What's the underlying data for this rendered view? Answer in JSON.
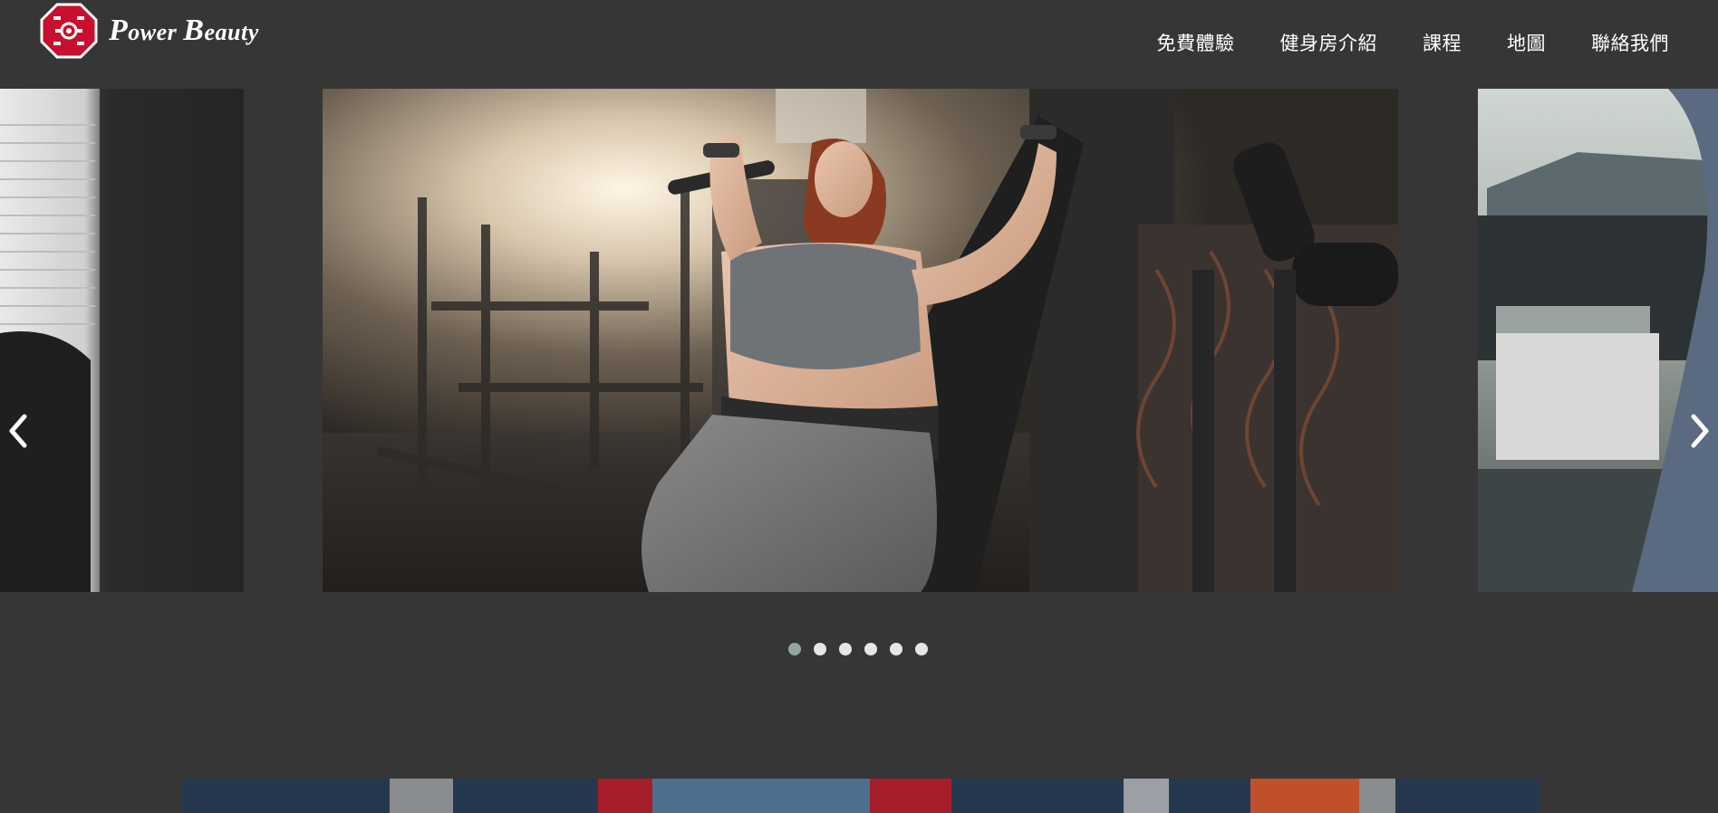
{
  "brand": {
    "name_part1_cap": "P",
    "name_part1": "ower",
    "name_part2_cap": "B",
    "name_part2": "eauty",
    "accent_color": "#c8102e"
  },
  "nav": {
    "items": [
      {
        "label": "免費體驗"
      },
      {
        "label": "健身房介紹"
      },
      {
        "label": "課程"
      },
      {
        "label": "地圖"
      },
      {
        "label": "聯絡我們"
      }
    ]
  },
  "carousel": {
    "prev_icon": "chevron-left-icon",
    "next_icon": "chevron-right-icon",
    "slide_count": 6,
    "active_index": 0,
    "slides": [
      {
        "subject": "woman-on-chest-press-machine"
      },
      {
        "subject": "harbor-scene"
      },
      {
        "subject": "window-blinds-person"
      }
    ],
    "dot_color": "#e6e6e6",
    "dot_active_color": "#97a59f"
  },
  "page": {
    "background": "#363636"
  }
}
